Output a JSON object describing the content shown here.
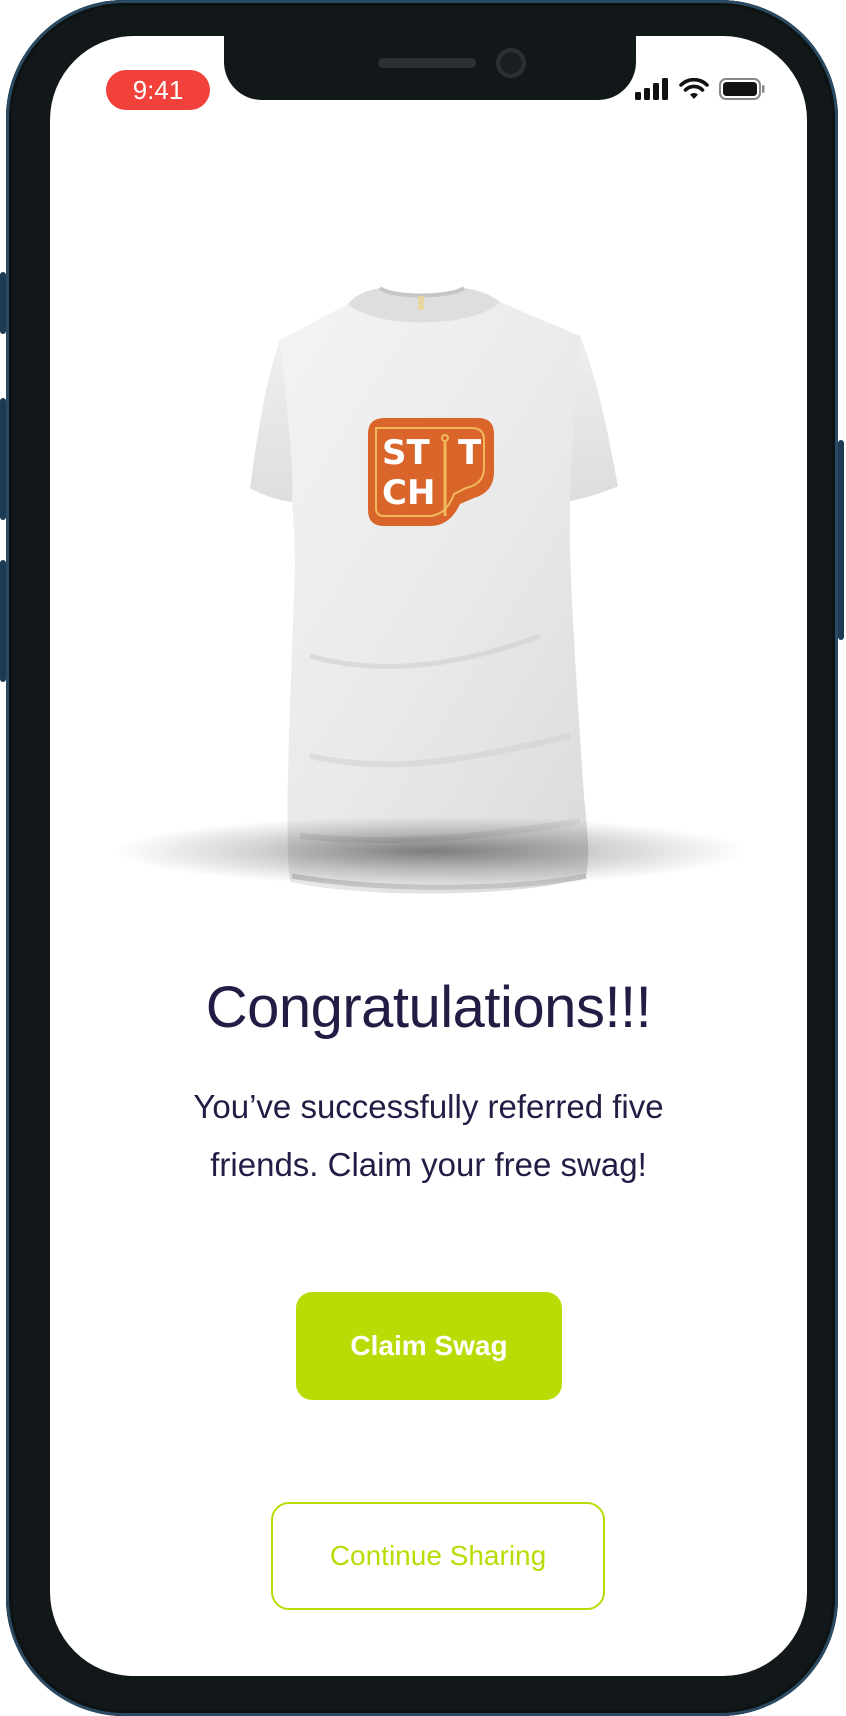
{
  "status_bar": {
    "time": "9:41",
    "icons": [
      "cellular-signal-icon",
      "wifi-icon",
      "battery-icon"
    ]
  },
  "product": {
    "image": "tshirt-with-stitch-logo",
    "logo_text": "STITCH"
  },
  "content": {
    "headline": "Congratulations!!!",
    "message": "You’ve successfully referred five friends. Claim your free swag!"
  },
  "actions": {
    "primary_label": "Claim Swag",
    "secondary_label": "Continue Sharing"
  },
  "colors": {
    "accent": "#b8dd06",
    "text": "#221d45",
    "logo": "#d9652b",
    "time_pill": "#f2413a"
  }
}
